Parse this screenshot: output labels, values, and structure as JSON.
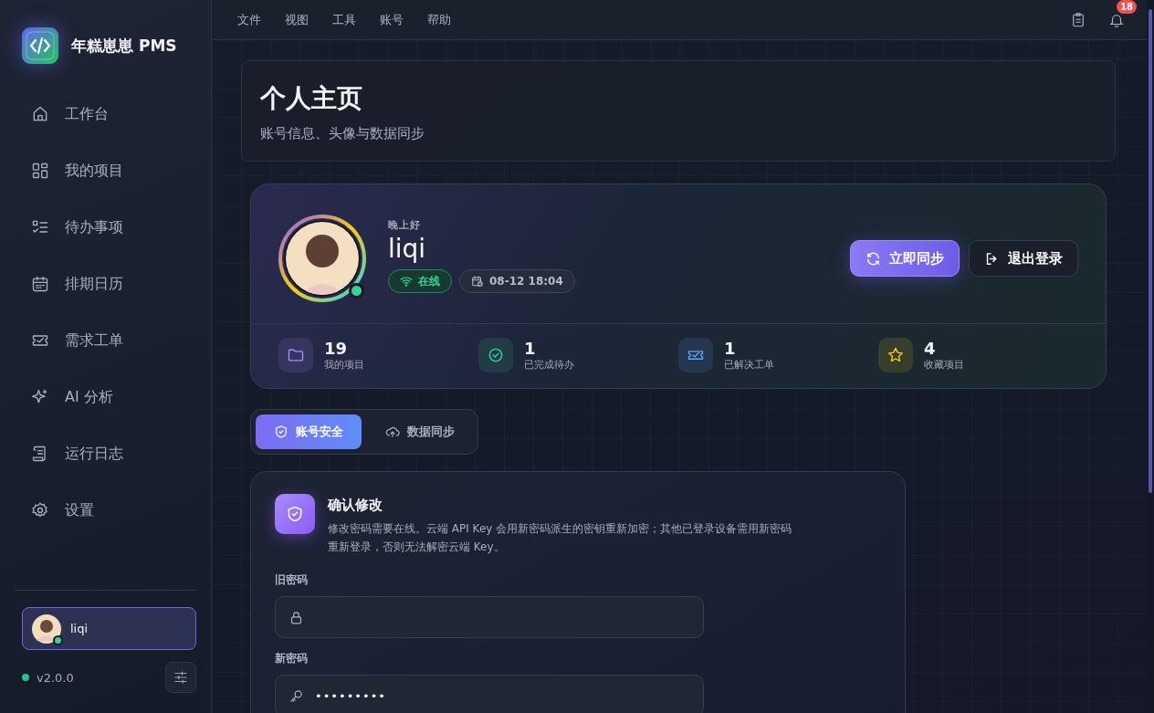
{
  "app": {
    "name": "年糕崽崽 PMS"
  },
  "sidebar": {
    "items": [
      {
        "label": "工作台",
        "kind": "home",
        "selected": false
      },
      {
        "label": "我的项目",
        "kind": "grid",
        "selected": false
      },
      {
        "label": "待办事项",
        "kind": "todo",
        "selected": false
      },
      {
        "label": "排期日历",
        "kind": "calendar",
        "selected": false
      },
      {
        "label": "需求工单",
        "kind": "ticket",
        "selected": false
      },
      {
        "label": "AI 分析",
        "kind": "sparkle",
        "selected": false
      },
      {
        "label": "运行日志",
        "kind": "scroll",
        "selected": false
      },
      {
        "label": "设置",
        "kind": "gear",
        "selected": false
      }
    ],
    "user": {
      "name": "liqi",
      "online": true
    },
    "version": "v2.0.0",
    "version_ok": true
  },
  "menu": [
    "文件",
    "视图",
    "工具",
    "账号",
    "帮助"
  ],
  "notifications": {
    "count": "18"
  },
  "page": {
    "title": "个人主页",
    "subtitle": "账号信息、头像与数据同步"
  },
  "profile": {
    "greeting": "晚上好",
    "name": "liqi",
    "online": true,
    "status": "在线",
    "time": "08-12 18:04",
    "buttons": [
      {
        "label": "立即同步",
        "kind": "primary"
      },
      {
        "label": "退出登录",
        "kind": "secondary"
      }
    ],
    "stats": [
      {
        "value": "19",
        "label": "我的项目",
        "kind": "folder",
        "color": "#a78bfa"
      },
      {
        "value": "1",
        "label": "已完成待办",
        "kind": "check",
        "color": "#34d399"
      },
      {
        "value": "1",
        "label": "已解决工单",
        "kind": "ticket",
        "color": "#60a5fa"
      },
      {
        "value": "4",
        "label": "收藏项目",
        "kind": "star",
        "color": "#facc15"
      }
    ]
  },
  "tabs": [
    {
      "label": "账号安全",
      "kind": "shield",
      "selected": true
    },
    {
      "label": "数据同步",
      "kind": "cloud",
      "selected": false
    }
  ],
  "form": {
    "title": "确认修改",
    "description": "修改密码需要在线。云端 API Key 会用新密码派生的密钥重新加密；其他已登录设备需用新密码重新登录，否则无法解密云端 Key。",
    "fields": [
      {
        "label": "旧密码",
        "kind": "lock"
      },
      {
        "label": "新密码",
        "kind": "key",
        "value": "•••••••••"
      }
    ]
  }
}
